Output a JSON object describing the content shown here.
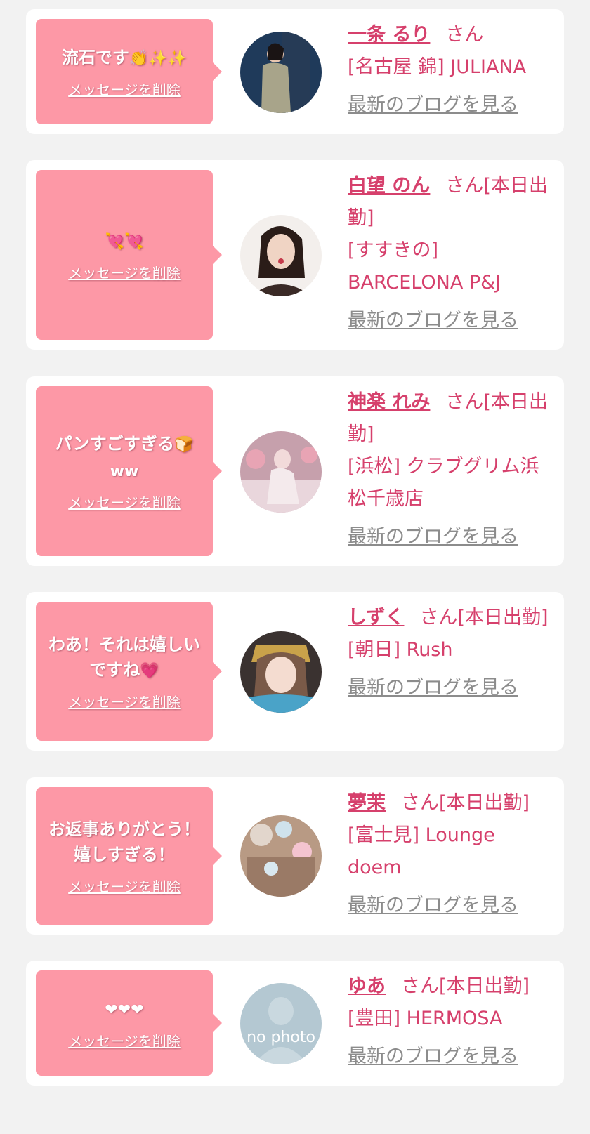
{
  "delete_label": "メッセージを削除",
  "blog_label": "最新のブログを見る",
  "messages": [
    {
      "message": "流石です",
      "emoji": "👏✨✨",
      "name": "一条 るり",
      "honorific": "さん",
      "shop": "[名古屋 錦] JULIANA"
    },
    {
      "message": "",
      "emoji": "💘💘",
      "name": "白望 のん",
      "honorific": "さん[本日出勤]",
      "shop": "[すすきの] BARCELONA P&J"
    },
    {
      "message": "パンすごすぎる",
      "emoji": "🍞ww",
      "name": "神楽 れみ",
      "honorific": "さん[本日出勤]",
      "shop": "[浜松] クラブグリム浜松千歳店"
    },
    {
      "message": "わあ！それは嬉しいですね",
      "emoji": "💗",
      "name": "しずく",
      "honorific": "さん[本日出勤]",
      "shop": "[朝日] Rush"
    },
    {
      "message": "お返事ありがとう！嬉しすぎる！",
      "emoji": "",
      "name": "夢茉",
      "honorific": "さん[本日出勤]",
      "shop": "[富士見] Lounge doem"
    },
    {
      "message": "",
      "emoji": "❤❤❤",
      "name": "ゆあ",
      "honorific": "さん[本日出勤]",
      "shop": "[豊田] HERMOSA",
      "avatar_text": "no photo"
    }
  ],
  "colors": {
    "background": "#f2f2f2",
    "bubble": "#fd98a6",
    "accent": "#d6406c",
    "link_gray": "#8c8c8c"
  }
}
